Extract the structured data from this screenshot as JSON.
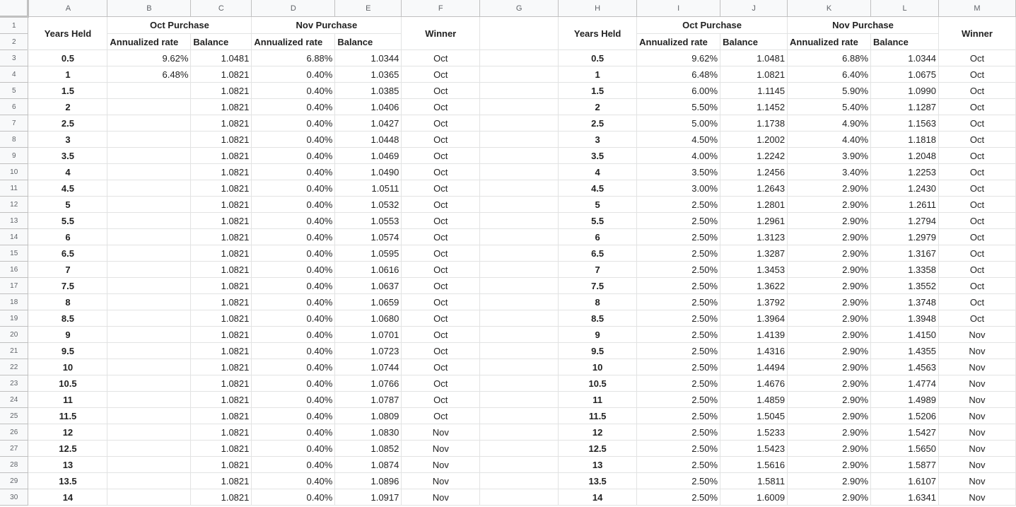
{
  "columns": [
    "A",
    "B",
    "C",
    "D",
    "E",
    "F",
    "G",
    "H",
    "I",
    "J",
    "K",
    "L",
    "M"
  ],
  "left": {
    "years_held": "Years Held",
    "oct_purchase": "Oct Purchase",
    "nov_purchase": "Nov Purchase",
    "winner": "Winner",
    "annualized_rate": "Annualized rate",
    "balance": "Balance",
    "rows": [
      [
        "0.5",
        "9.62%",
        "1.0481",
        "6.88%",
        "1.0344",
        "Oct"
      ],
      [
        "1",
        "6.48%",
        "1.0821",
        "0.40%",
        "1.0365",
        "Oct"
      ],
      [
        "1.5",
        "",
        "1.0821",
        "0.40%",
        "1.0385",
        "Oct"
      ],
      [
        "2",
        "",
        "1.0821",
        "0.40%",
        "1.0406",
        "Oct"
      ],
      [
        "2.5",
        "",
        "1.0821",
        "0.40%",
        "1.0427",
        "Oct"
      ],
      [
        "3",
        "",
        "1.0821",
        "0.40%",
        "1.0448",
        "Oct"
      ],
      [
        "3.5",
        "",
        "1.0821",
        "0.40%",
        "1.0469",
        "Oct"
      ],
      [
        "4",
        "",
        "1.0821",
        "0.40%",
        "1.0490",
        "Oct"
      ],
      [
        "4.5",
        "",
        "1.0821",
        "0.40%",
        "1.0511",
        "Oct"
      ],
      [
        "5",
        "",
        "1.0821",
        "0.40%",
        "1.0532",
        "Oct"
      ],
      [
        "5.5",
        "",
        "1.0821",
        "0.40%",
        "1.0553",
        "Oct"
      ],
      [
        "6",
        "",
        "1.0821",
        "0.40%",
        "1.0574",
        "Oct"
      ],
      [
        "6.5",
        "",
        "1.0821",
        "0.40%",
        "1.0595",
        "Oct"
      ],
      [
        "7",
        "",
        "1.0821",
        "0.40%",
        "1.0616",
        "Oct"
      ],
      [
        "7.5",
        "",
        "1.0821",
        "0.40%",
        "1.0637",
        "Oct"
      ],
      [
        "8",
        "",
        "1.0821",
        "0.40%",
        "1.0659",
        "Oct"
      ],
      [
        "8.5",
        "",
        "1.0821",
        "0.40%",
        "1.0680",
        "Oct"
      ],
      [
        "9",
        "",
        "1.0821",
        "0.40%",
        "1.0701",
        "Oct"
      ],
      [
        "9.5",
        "",
        "1.0821",
        "0.40%",
        "1.0723",
        "Oct"
      ],
      [
        "10",
        "",
        "1.0821",
        "0.40%",
        "1.0744",
        "Oct"
      ],
      [
        "10.5",
        "",
        "1.0821",
        "0.40%",
        "1.0766",
        "Oct"
      ],
      [
        "11",
        "",
        "1.0821",
        "0.40%",
        "1.0787",
        "Oct"
      ],
      [
        "11.5",
        "",
        "1.0821",
        "0.40%",
        "1.0809",
        "Oct"
      ],
      [
        "12",
        "",
        "1.0821",
        "0.40%",
        "1.0830",
        "Nov"
      ],
      [
        "12.5",
        "",
        "1.0821",
        "0.40%",
        "1.0852",
        "Nov"
      ],
      [
        "13",
        "",
        "1.0821",
        "0.40%",
        "1.0874",
        "Nov"
      ],
      [
        "13.5",
        "",
        "1.0821",
        "0.40%",
        "1.0896",
        "Nov"
      ],
      [
        "14",
        "",
        "1.0821",
        "0.40%",
        "1.0917",
        "Nov"
      ]
    ]
  },
  "right": {
    "years_held": "Years Held",
    "oct_purchase": "Oct Purchase",
    "nov_purchase": "Nov Purchase",
    "winner": "Winner",
    "annualized_rate": "Annualized rate",
    "balance": "Balance",
    "rows": [
      [
        "0.5",
        "9.62%",
        "1.0481",
        "6.88%",
        "1.0344",
        "Oct"
      ],
      [
        "1",
        "6.48%",
        "1.0821",
        "6.40%",
        "1.0675",
        "Oct"
      ],
      [
        "1.5",
        "6.00%",
        "1.1145",
        "5.90%",
        "1.0990",
        "Oct"
      ],
      [
        "2",
        "5.50%",
        "1.1452",
        "5.40%",
        "1.1287",
        "Oct"
      ],
      [
        "2.5",
        "5.00%",
        "1.1738",
        "4.90%",
        "1.1563",
        "Oct"
      ],
      [
        "3",
        "4.50%",
        "1.2002",
        "4.40%",
        "1.1818",
        "Oct"
      ],
      [
        "3.5",
        "4.00%",
        "1.2242",
        "3.90%",
        "1.2048",
        "Oct"
      ],
      [
        "4",
        "3.50%",
        "1.2456",
        "3.40%",
        "1.2253",
        "Oct"
      ],
      [
        "4.5",
        "3.00%",
        "1.2643",
        "2.90%",
        "1.2430",
        "Oct"
      ],
      [
        "5",
        "2.50%",
        "1.2801",
        "2.90%",
        "1.2611",
        "Oct"
      ],
      [
        "5.5",
        "2.50%",
        "1.2961",
        "2.90%",
        "1.2794",
        "Oct"
      ],
      [
        "6",
        "2.50%",
        "1.3123",
        "2.90%",
        "1.2979",
        "Oct"
      ],
      [
        "6.5",
        "2.50%",
        "1.3287",
        "2.90%",
        "1.3167",
        "Oct"
      ],
      [
        "7",
        "2.50%",
        "1.3453",
        "2.90%",
        "1.3358",
        "Oct"
      ],
      [
        "7.5",
        "2.50%",
        "1.3622",
        "2.90%",
        "1.3552",
        "Oct"
      ],
      [
        "8",
        "2.50%",
        "1.3792",
        "2.90%",
        "1.3748",
        "Oct"
      ],
      [
        "8.5",
        "2.50%",
        "1.3964",
        "2.90%",
        "1.3948",
        "Oct"
      ],
      [
        "9",
        "2.50%",
        "1.4139",
        "2.90%",
        "1.4150",
        "Nov"
      ],
      [
        "9.5",
        "2.50%",
        "1.4316",
        "2.90%",
        "1.4355",
        "Nov"
      ],
      [
        "10",
        "2.50%",
        "1.4494",
        "2.90%",
        "1.4563",
        "Nov"
      ],
      [
        "10.5",
        "2.50%",
        "1.4676",
        "2.90%",
        "1.4774",
        "Nov"
      ],
      [
        "11",
        "2.50%",
        "1.4859",
        "2.90%",
        "1.4989",
        "Nov"
      ],
      [
        "11.5",
        "2.50%",
        "1.5045",
        "2.90%",
        "1.5206",
        "Nov"
      ],
      [
        "12",
        "2.50%",
        "1.5233",
        "2.90%",
        "1.5427",
        "Nov"
      ],
      [
        "12.5",
        "2.50%",
        "1.5423",
        "2.90%",
        "1.5650",
        "Nov"
      ],
      [
        "13",
        "2.50%",
        "1.5616",
        "2.90%",
        "1.5877",
        "Nov"
      ],
      [
        "13.5",
        "2.50%",
        "1.5811",
        "2.90%",
        "1.6107",
        "Nov"
      ],
      [
        "14",
        "2.50%",
        "1.6009",
        "2.90%",
        "1.6341",
        "Nov"
      ]
    ]
  }
}
